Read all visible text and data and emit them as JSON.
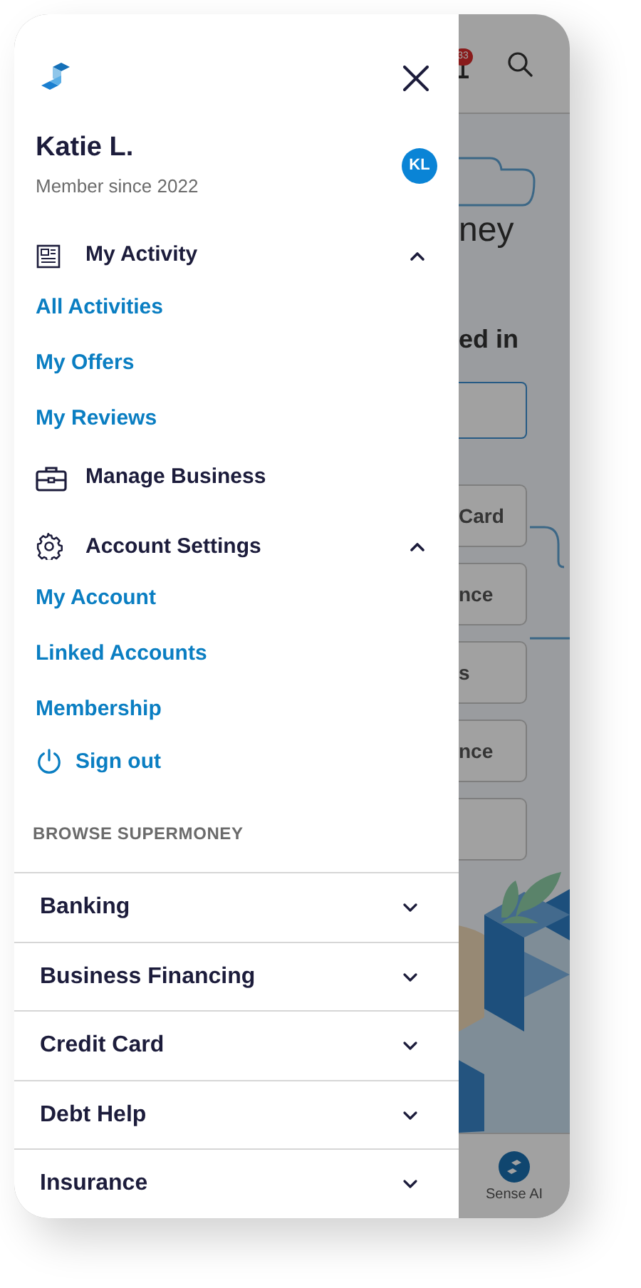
{
  "user": {
    "name": "Katie L.",
    "member_since": "Member since 2022",
    "initials": "KL"
  },
  "menu": [
    {
      "kind": "group",
      "label": "My Activity",
      "expanded": true,
      "children": [
        {
          "label": "All Activities"
        },
        {
          "label": "My Offers"
        },
        {
          "label": "My Reviews"
        }
      ]
    },
    {
      "kind": "item",
      "label": "Manage Business"
    },
    {
      "kind": "group",
      "label": "Account Settings",
      "expanded": true,
      "children": [
        {
          "label": "My Account"
        },
        {
          "label": "Linked Accounts"
        },
        {
          "label": "Membership"
        }
      ]
    },
    {
      "kind": "signout",
      "label": "Sign out"
    }
  ],
  "browse": {
    "heading": "BROWSE SUPERMONEY",
    "categories": [
      {
        "label": "Banking",
        "expanded": false
      },
      {
        "label": "Business Financing",
        "expanded": false
      },
      {
        "label": "Credit Card",
        "expanded": false
      },
      {
        "label": "Debt Help",
        "expanded": false
      },
      {
        "label": "Insurance",
        "expanded": false
      }
    ]
  },
  "background_page": {
    "notification_count": "33",
    "title_fragment": "ney",
    "question_fragment": "ed in",
    "options": [
      "Card",
      "nce",
      "s",
      "nce"
    ],
    "bottom_nav": [
      {
        "label": "Sense AI"
      }
    ]
  }
}
